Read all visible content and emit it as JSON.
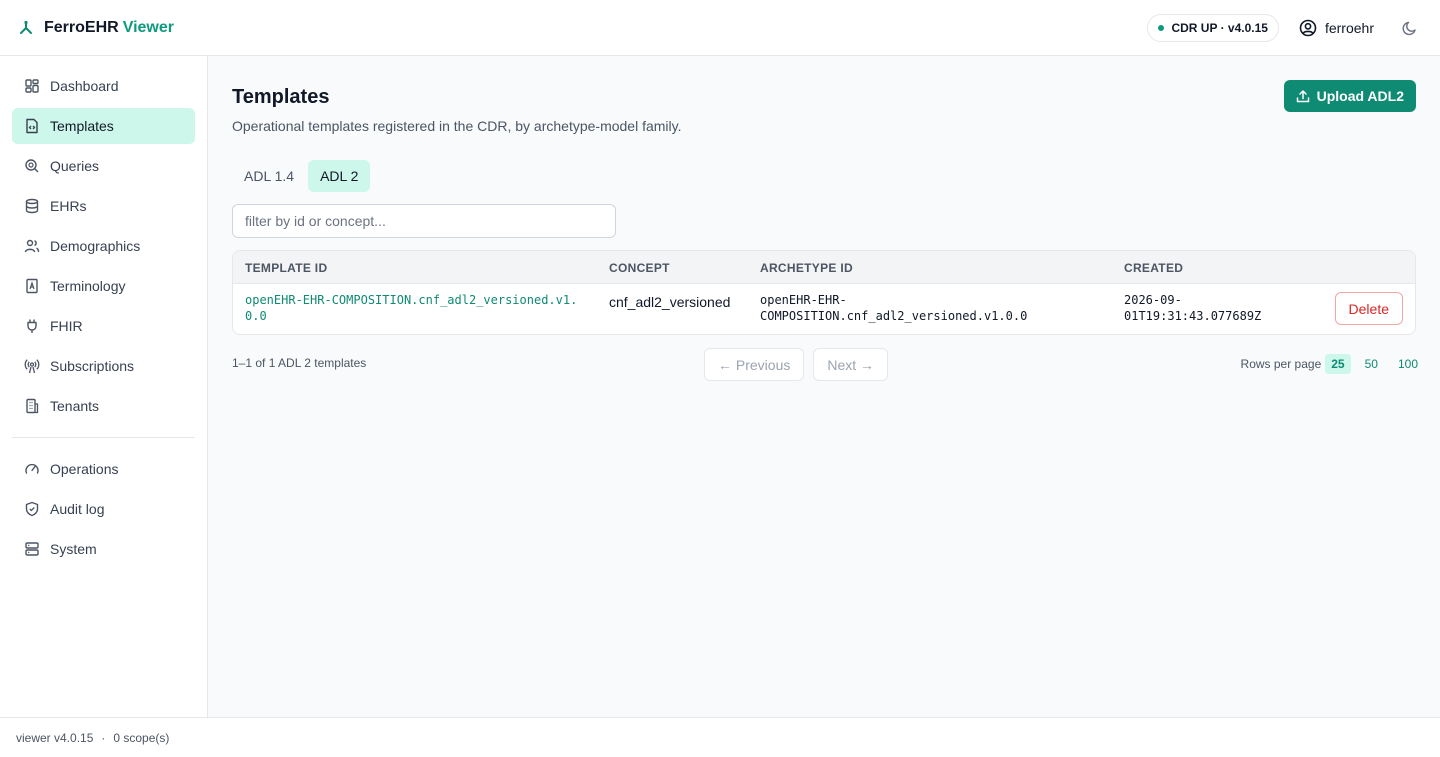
{
  "header": {
    "brand_name": "FerroEHR",
    "brand_accent": "Viewer",
    "status": "CDR UP · v4.0.15",
    "username": "ferroehr"
  },
  "sidebar": {
    "items": [
      {
        "label": "Dashboard",
        "icon": "grid-icon",
        "active": false
      },
      {
        "label": "Templates",
        "icon": "file-code-icon",
        "active": true
      },
      {
        "label": "Queries",
        "icon": "search-icon",
        "active": false
      },
      {
        "label": "EHRs",
        "icon": "database-icon",
        "active": false
      },
      {
        "label": "Demographics",
        "icon": "users-icon",
        "active": false
      },
      {
        "label": "Terminology",
        "icon": "book-icon",
        "active": false
      },
      {
        "label": "FHIR",
        "icon": "plug-icon",
        "active": false
      },
      {
        "label": "Subscriptions",
        "icon": "broadcast-icon",
        "active": false
      },
      {
        "label": "Tenants",
        "icon": "building-icon",
        "active": false
      }
    ],
    "secondary": [
      {
        "label": "Operations",
        "icon": "gauge-icon"
      },
      {
        "label": "Audit log",
        "icon": "shield-icon"
      },
      {
        "label": "System",
        "icon": "server-icon"
      }
    ]
  },
  "page": {
    "title": "Templates",
    "subtitle": "Operational templates registered in the CDR, by archetype-model family.",
    "upload_label": "Upload ADL2",
    "tabs": [
      {
        "label": "ADL 1.4",
        "active": false
      },
      {
        "label": "ADL 2",
        "active": true
      }
    ],
    "filter_placeholder": "filter by id or concept..."
  },
  "table": {
    "headers": [
      "TEMPLATE ID",
      "CONCEPT",
      "ARCHETYPE ID",
      "CREATED"
    ],
    "rows": [
      {
        "template_id": "openEHR-EHR-COMPOSITION.cnf_adl2_versioned.v1.0.0",
        "concept": "cnf_adl2_versioned",
        "archetype_id": "openEHR-EHR-COMPOSITION.cnf_adl2_versioned.v1.0.0",
        "created": "2026-09-01T19:31:43.077689Z",
        "delete_label": "Delete"
      }
    ]
  },
  "pagination": {
    "count_text": "1–1 of 1 ADL 2 templates",
    "previous_label": "← Previous",
    "next_label": "Next →",
    "rows_label": "Rows per page",
    "options": [
      "25",
      "50",
      "100"
    ],
    "selected": "25"
  },
  "footer": {
    "version": "viewer v4.0.15",
    "separator": "·",
    "scopes": "0 scope(s)"
  },
  "colors": {
    "accent": "#0f8a73",
    "active_bg": "#ccf7ea",
    "danger": "#dc2626"
  }
}
